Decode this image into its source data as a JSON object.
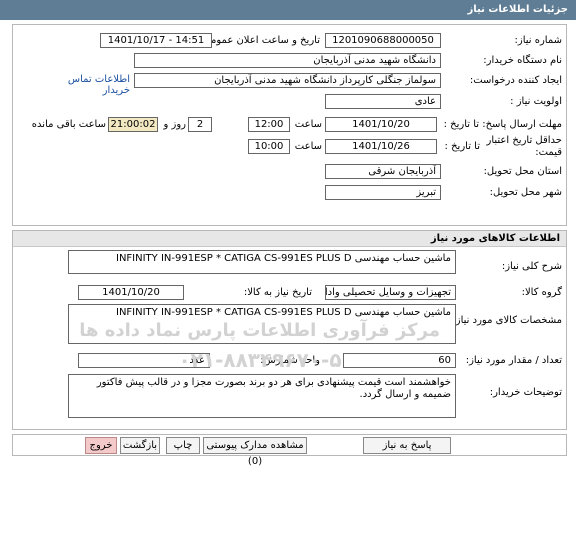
{
  "page_title": "جزئیات اطلاعات نیاز",
  "info": {
    "need_number_label": "شماره نیاز:",
    "need_number": "1201090688000050",
    "announce_label": "تاریخ و ساعت اعلان عمومی:",
    "announce_value": "1401/10/17 - 14:51",
    "buyer_org_label": "نام دستگاه خریدار:",
    "buyer_org": "دانشگاه شهید مدنی آذربایجان",
    "creator_label": "ایجاد کننده درخواست:",
    "creator": "سولماز جنگلی کارپرداز دانشگاه شهید مدنی آذربایجان",
    "contact_link": "اطلاعات تماس خریدار",
    "priority_label": "اولویت نیاز :",
    "priority": "عادی",
    "deadline_label": "مهلت ارسال پاسخ: تا تاریخ :",
    "deadline_date": "1401/10/20",
    "time_label": "ساعت",
    "deadline_time": "12:00",
    "days_value": "2",
    "days_label": "روز و",
    "remaining_time": "21:00:02",
    "remaining_label": "ساعت باقی مانده",
    "min_validity_label_1": "حداقل تاریخ اعتبار",
    "min_validity_label_2": "قیمت:",
    "min_validity_to": "تا تاریخ :",
    "validity_date": "1401/10/26",
    "validity_time_label": "ساعت",
    "validity_time": "10:00",
    "province_label": "استان محل تحویل:",
    "province": "آذربایجان شرقی",
    "city_label": "شهر محل تحویل:",
    "city": "تبریز"
  },
  "goods": {
    "header": "اطلاعات کالاهای مورد نیاز",
    "summary_label": "شرح کلی نیاز:",
    "summary": "ماشین حساب مهندسی  INFINITY IN-991ESP * CATIGA CS-991ES PLUS D",
    "group_label": "گروه کالا:",
    "group": "تجهیزات و وسایل تحصیلی واداری",
    "need_date_label": "تاریخ نیاز به کالا:",
    "need_date": "1401/10/20",
    "spec_label": "مشخصات کالای مورد نیاز:",
    "spec": "ماشین حساب مهندسی  INFINITY IN-991ESP * CATIGA CS-991ES PLUS D",
    "qty_label": "تعداد / مقدار مورد نیاز:",
    "qty": "60",
    "unit_label": "واحد شمارش:",
    "unit": "عدد",
    "notes_label": "توضیحات خریدار:",
    "notes": "خواهشمند است قیمت پیشنهادی برای هر دو برند بصورت مجزا و در قالب پیش فاکتور  ضمیمه و ارسال گردد."
  },
  "watermark": {
    "line1": "مرکز فرآوری اطلاعات پارس نماد داده ها",
    "line2": "۰۲۱-۸۸۳۴۹۶۷۰-۵"
  },
  "buttons": {
    "reply": "پاسخ به نیاز",
    "attachments": "مشاهده مدارک پیوستی (0)",
    "print": "چاپ",
    "back": "بازگشت",
    "exit": "خروج"
  }
}
